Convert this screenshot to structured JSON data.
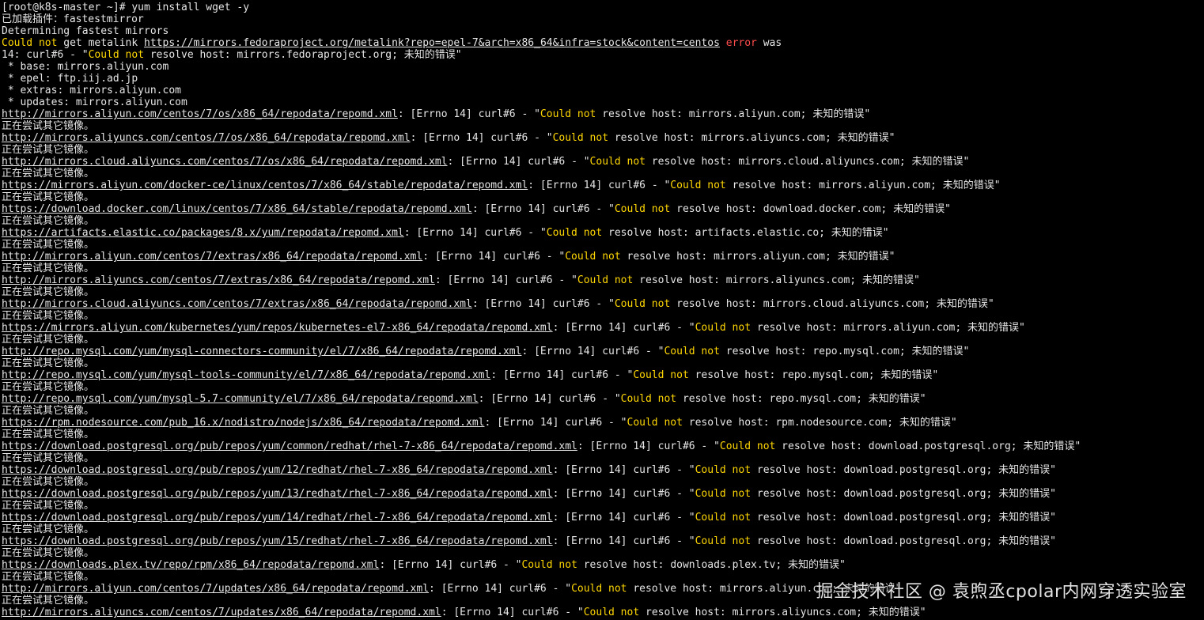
{
  "terminal": {
    "command_line": "[root@k8s-master ~]# yum install wget -y",
    "plugin_line": "已加载插件：fastestmirror",
    "determining": "Determining fastest mirrors",
    "metalink": {
      "prefix": "Could not",
      "mid": " get metalink ",
      "url": "https://mirrors.fedoraproject.org/metalink?repo=epel-7&arch=x86_64&infra=stock&content=centos",
      "error_word": " error",
      "suffix": " was"
    },
    "curl_line": {
      "prefix": "14: curl#6 - \"",
      "cn": "Could not",
      "rest": " resolve host: mirrors.fedoraproject.org; 未知的错误\""
    },
    "mirror_list": [
      " * base: mirrors.aliyun.com",
      " * epel: ftp.iij.ad.jp",
      " * extras: mirrors.aliyun.com",
      " * updates: mirrors.aliyun.com"
    ],
    "errno_mid": ": [Errno 14] curl#6 - \"",
    "could_not": "Could not",
    "resolve_host": " resolve host: ",
    "unknown_error": "; 未知的错误\"",
    "retry_text": "正在尝试其它镜像。",
    "errors": [
      {
        "url": "http://mirrors.aliyun.com/centos/7/os/x86_64/repodata/repomd.xml",
        "host": "mirrors.aliyun.com"
      },
      {
        "url": "http://mirrors.aliyuncs.com/centos/7/os/x86_64/repodata/repomd.xml",
        "host": "mirrors.aliyuncs.com"
      },
      {
        "url": "http://mirrors.cloud.aliyuncs.com/centos/7/os/x86_64/repodata/repomd.xml",
        "host": "mirrors.cloud.aliyuncs.com"
      },
      {
        "url": "https://mirrors.aliyun.com/docker-ce/linux/centos/7/x86_64/stable/repodata/repomd.xml",
        "host": "mirrors.aliyun.com"
      },
      {
        "url": "https://download.docker.com/linux/centos/7/x86_64/stable/repodata/repomd.xml",
        "host": "download.docker.com"
      },
      {
        "url": "https://artifacts.elastic.co/packages/8.x/yum/repodata/repomd.xml",
        "host": "artifacts.elastic.co"
      },
      {
        "url": "http://mirrors.aliyun.com/centos/7/extras/x86_64/repodata/repomd.xml",
        "host": "mirrors.aliyun.com"
      },
      {
        "url": "http://mirrors.aliyuncs.com/centos/7/extras/x86_64/repodata/repomd.xml",
        "host": "mirrors.aliyuncs.com"
      },
      {
        "url": "http://mirrors.cloud.aliyuncs.com/centos/7/extras/x86_64/repodata/repomd.xml",
        "host": "mirrors.cloud.aliyuncs.com"
      },
      {
        "url": "https://mirrors.aliyun.com/kubernetes/yum/repos/kubernetes-el7-x86_64/repodata/repomd.xml",
        "host": "mirrors.aliyun.com"
      },
      {
        "url": "http://repo.mysql.com/yum/mysql-connectors-community/el/7/x86_64/repodata/repomd.xml",
        "host": "repo.mysql.com"
      },
      {
        "url": "http://repo.mysql.com/yum/mysql-tools-community/el/7/x86_64/repodata/repomd.xml",
        "host": "repo.mysql.com"
      },
      {
        "url": "http://repo.mysql.com/yum/mysql-5.7-community/el/7/x86_64/repodata/repomd.xml",
        "host": "repo.mysql.com"
      },
      {
        "url": "https://rpm.nodesource.com/pub_16.x/nodistro/nodejs/x86_64/repodata/repomd.xml",
        "host": "rpm.nodesource.com"
      },
      {
        "url": "https://download.postgresql.org/pub/repos/yum/common/redhat/rhel-7-x86_64/repodata/repomd.xml",
        "host": "download.postgresql.org"
      },
      {
        "url": "https://download.postgresql.org/pub/repos/yum/12/redhat/rhel-7-x86_64/repodata/repomd.xml",
        "host": "download.postgresql.org"
      },
      {
        "url": "https://download.postgresql.org/pub/repos/yum/13/redhat/rhel-7-x86_64/repodata/repomd.xml",
        "host": "download.postgresql.org"
      },
      {
        "url": "https://download.postgresql.org/pub/repos/yum/14/redhat/rhel-7-x86_64/repodata/repomd.xml",
        "host": "download.postgresql.org"
      },
      {
        "url": "https://download.postgresql.org/pub/repos/yum/15/redhat/rhel-7-x86_64/repodata/repomd.xml",
        "host": "download.postgresql.org"
      },
      {
        "url": "https://downloads.plex.tv/repo/rpm/x86_64/repodata/repomd.xml",
        "host": "downloads.plex.tv"
      },
      {
        "url": "http://mirrors.aliyun.com/centos/7/updates/x86_64/repodata/repomd.xml",
        "host": "mirrors.aliyun.com"
      },
      {
        "url": "http://mirrors.aliyuncs.com/centos/7/updates/x86_64/repodata/repomd.xml",
        "host": "mirrors.aliyuncs.com"
      }
    ]
  },
  "watermark": "掘金技术社区 @ 袁煦丞cpolar内网穿透实验室",
  "colors": {
    "background": "#000000",
    "text": "#e6e6e6",
    "could_not": "#ffd700",
    "error": "#ff4d4d"
  }
}
